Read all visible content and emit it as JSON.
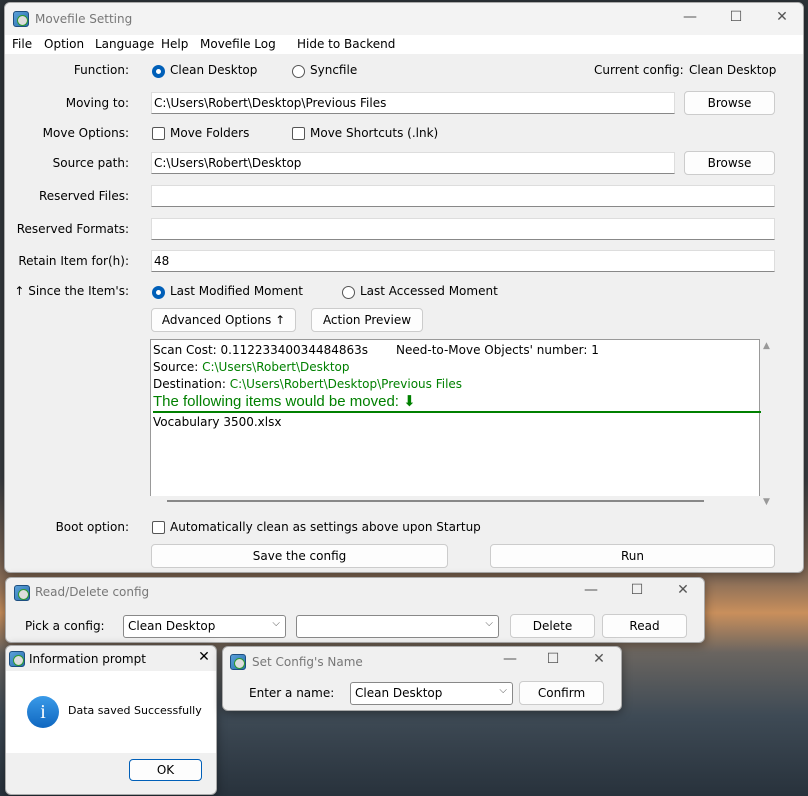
{
  "main": {
    "title": "Movefile Setting",
    "menu": [
      "File",
      "Option",
      "Language",
      "Help",
      "Movefile Log",
      "Hide to Backend"
    ],
    "function_label": "Function:",
    "function_options": [
      "Clean Desktop",
      "Syncfile"
    ],
    "current_config_label": "Current config:",
    "current_config_value": "Clean Desktop",
    "moving_to_label": "Moving to:",
    "moving_to_value": "C:\\Users\\Robert\\Desktop\\Previous Files",
    "browse": "Browse",
    "move_options_label": "Move Options:",
    "move_folders": "Move Folders",
    "move_shortcuts": "Move Shortcuts (.lnk)",
    "source_path_label": "Source path:",
    "source_path_value": "C:\\Users\\Robert\\Desktop",
    "reserved_files_label": "Reserved Files:",
    "reserved_formats_label": "Reserved Formats:",
    "retain_label": "Retain Item for(h):",
    "retain_value": "48",
    "since_label": "↑ Since the Item's:",
    "since_options": [
      "Last Modified Moment",
      "Last Accessed Moment"
    ],
    "advanced_options": "Advanced Options ↑",
    "action_preview": "Action Preview",
    "preview": {
      "scan_cost": "Scan Cost: 0.11223340034484863s",
      "need_to_move": "Need-to-Move Objects' number:   1",
      "source_label": "Source: ",
      "source_value": "C:\\Users\\Robert\\Desktop",
      "destination_label": "Destination: ",
      "destination_value": "C:\\Users\\Robert\\Desktop\\Previous Files",
      "heading": "The following items would be moved: ⬇",
      "items": [
        "Vocabulary 3500.xlsx"
      ]
    },
    "boot_label": "Boot option:",
    "boot_checkbox": "Automatically clean as settings above upon Startup",
    "save_config": "Save the config",
    "run": "Run"
  },
  "read_delete": {
    "title": "Read/Delete config",
    "pick_label": "Pick a config:",
    "config_value": "Clean Desktop",
    "second_value": "",
    "delete": "Delete",
    "read": "Read"
  },
  "info": {
    "title": "Information prompt",
    "message": "Data saved Successfully",
    "ok": "OK"
  },
  "set_name": {
    "title": "Set Config's Name",
    "label": "Enter a name:",
    "value": "Clean Desktop",
    "confirm": "Confirm"
  },
  "colors": {
    "accent": "#005fb8",
    "green": "#008000"
  }
}
